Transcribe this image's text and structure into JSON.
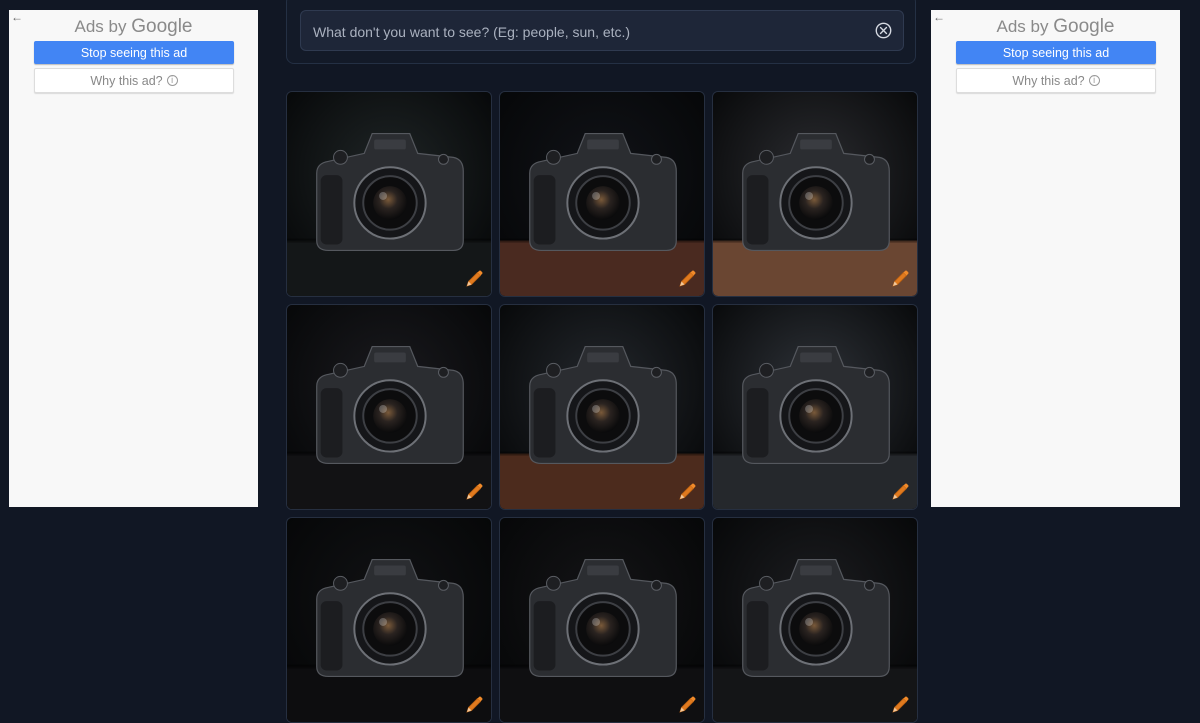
{
  "ads": {
    "header_prefix": "Ads by",
    "header_brand": "Google",
    "stop_label": "Stop seeing this ad",
    "why_label": "Why this ad?",
    "info_glyph": "i",
    "back_glyph": "←"
  },
  "search": {
    "placeholder": "What don't you want to see? (Eg: people, sun, etc.)",
    "value": ""
  },
  "gallery": {
    "items": [
      {
        "subject": "camera",
        "background": "#1f2526",
        "surface": "#141718"
      },
      {
        "subject": "camera",
        "background": "#111318",
        "surface": "#4a2a20"
      },
      {
        "subject": "camera",
        "background": "#2b2c30",
        "surface": "#6a4632"
      },
      {
        "subject": "camera",
        "background": "#1a1a1e",
        "surface": "#121214"
      },
      {
        "subject": "camera",
        "background": "#23272c",
        "surface": "#4c2b1d"
      },
      {
        "subject": "camera",
        "background": "#2e3238",
        "surface": "#25282c"
      },
      {
        "subject": "camera",
        "background": "#111214",
        "surface": "#0d0d0f"
      },
      {
        "subject": "camera",
        "background": "#141416",
        "surface": "#0f0f11"
      },
      {
        "subject": "camera",
        "background": "#1c1d20",
        "surface": "#141517"
      }
    ],
    "edit_icon": "pencil-icon",
    "accent": "#e07a1f"
  }
}
